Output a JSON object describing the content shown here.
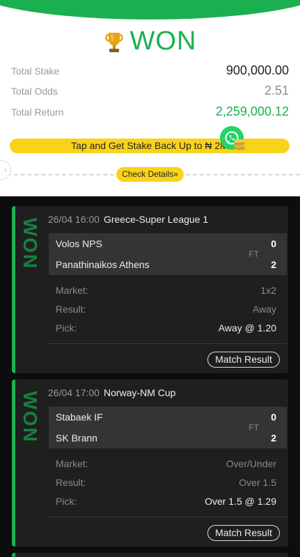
{
  "summary": {
    "status": "WON",
    "total_stake_label": "Total Stake",
    "total_stake": "900,000.00",
    "total_odds_label": "Total Odds",
    "total_odds": "2.51",
    "total_return_label": "Total Return",
    "total_return": "2,259,000.12",
    "promo_text": "Tap and Get Stake Back Up to ₦ 2M",
    "check_details": "Check Details"
  },
  "colors": {
    "accent": "#1bb04f",
    "promo": "#f9d21b",
    "card_bg": "#1f1f1f"
  },
  "bets": [
    {
      "status_stamp": "WON",
      "date": "26/04 16:00",
      "league": "Greece-Super League 1",
      "home": "Volos NPS",
      "away": "Panathinaikos Athens",
      "home_score": "0",
      "away_score": "2",
      "state": "FT",
      "market_label": "Market:",
      "market": "1x2",
      "result_label": "Result:",
      "result": "Away",
      "pick_label": "Pick:",
      "pick": "Away @ 1.20",
      "match_result_button": "Match Result"
    },
    {
      "status_stamp": "WON",
      "date": "26/04 17:00",
      "league": "Norway-NM Cup",
      "home": "Stabaek IF",
      "away": "SK Brann",
      "home_score": "0",
      "away_score": "2",
      "state": "FT",
      "market_label": "Market:",
      "market": "Over/Under",
      "result_label": "Result:",
      "result": "Over 1.5",
      "pick_label": "Pick:",
      "pick": "Over 1.5 @ 1.29",
      "match_result_button": "Match Result"
    }
  ]
}
